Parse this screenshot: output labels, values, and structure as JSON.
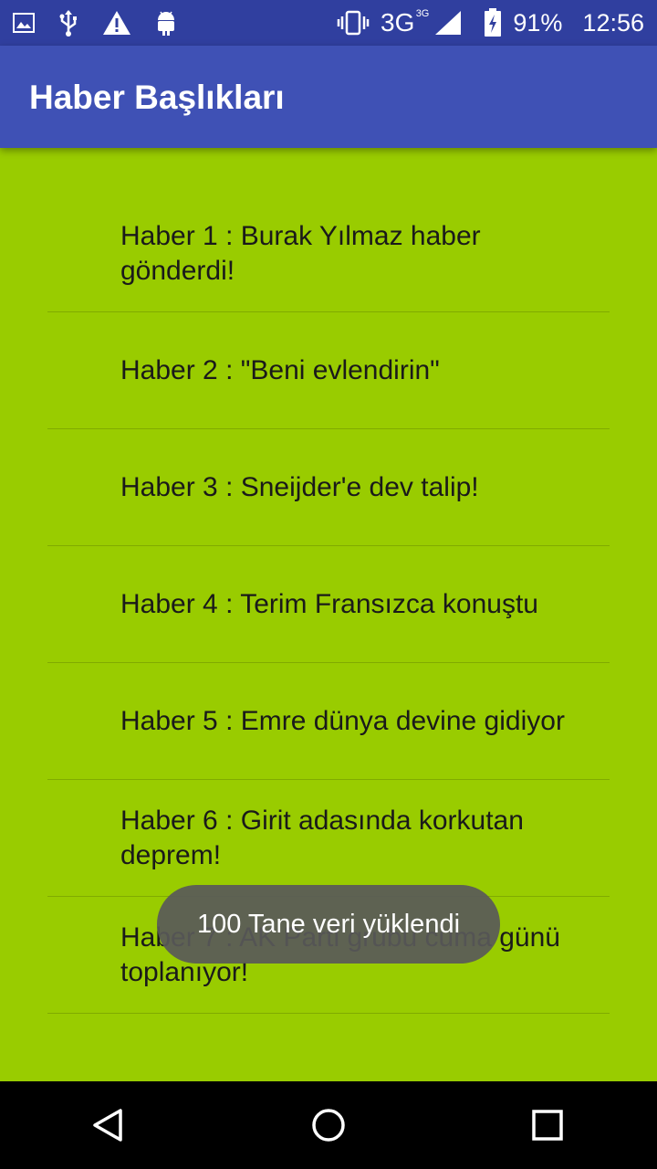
{
  "status_bar": {
    "network": "3G",
    "network_small": "3G",
    "battery": "91%",
    "time": "12:56",
    "icons_left": [
      "image-icon",
      "usb-icon",
      "warning-icon",
      "android-icon"
    ],
    "icons_right": [
      "vibrate-icon",
      "signal-icon",
      "battery-icon"
    ]
  },
  "app_bar": {
    "title": "Haber Başlıkları"
  },
  "news": [
    "Haber 1 : Burak Yılmaz haber gönderdi!",
    "Haber 2 : \"Beni evlendirin\"",
    "Haber 3 : Sneijder'e dev talip!",
    "Haber 4 : Terim Fransızca konuştu",
    "Haber 5 : Emre dünya devine gidiyor",
    "Haber 6 : Girit adasında korkutan deprem!",
    "Haber 7 : AK Parti grubu cuma günü toplanıyor!"
  ],
  "toast": {
    "text": "100 Tane veri yüklendi"
  },
  "colors": {
    "background": "#99cc00",
    "app_bar": "#3f51b5",
    "status_bar": "#303f9f",
    "toast": "#595959"
  },
  "nav_bar": {
    "buttons": [
      "back-icon",
      "home-icon",
      "recents-icon"
    ]
  }
}
